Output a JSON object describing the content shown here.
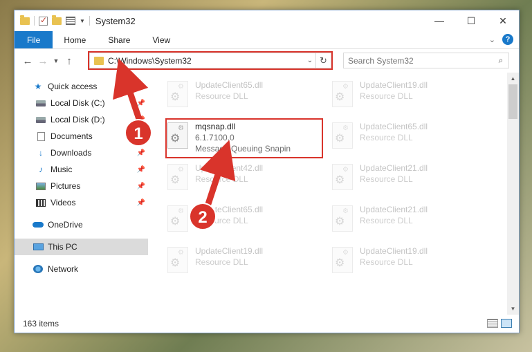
{
  "window": {
    "title": "System32",
    "controls": {
      "minimize": "—",
      "maximize": "☐",
      "close": "✕"
    }
  },
  "ribbon": {
    "tabs": [
      {
        "label": "File"
      },
      {
        "label": "Home"
      },
      {
        "label": "Share"
      },
      {
        "label": "View"
      }
    ]
  },
  "navigation": {
    "address": "C:\\Windows\\System32",
    "search_placeholder": "Search System32"
  },
  "sidebar": {
    "quick_access": "Quick access",
    "items": [
      {
        "label": "Local Disk (C:)"
      },
      {
        "label": "Local Disk (D:)"
      },
      {
        "label": "Documents"
      },
      {
        "label": "Downloads"
      },
      {
        "label": "Music"
      },
      {
        "label": "Pictures"
      },
      {
        "label": "Videos"
      }
    ],
    "onedrive": "OneDrive",
    "this_pc": "This PC",
    "network": "Network"
  },
  "files": [
    {
      "name": "UpdateClient65.dll",
      "type": "Resource DLL"
    },
    {
      "name": "UpdateClient19.dll",
      "type": "Resource DLL"
    },
    {
      "name": "mqsnap.dll",
      "version": "6.1.7100.0",
      "description": "Message Queuing Snapin"
    },
    {
      "name": "UpdateClient65.dll",
      "type": "Resource DLL"
    },
    {
      "name": "UpdateClient42.dll",
      "type": "Resource DLL"
    },
    {
      "name": "UpdateClient21.dll",
      "type": "Resource DLL"
    },
    {
      "name": "UpdateClient65.dll",
      "type": "Resource DLL"
    },
    {
      "name": "UpdateClient21.dll",
      "type": "Resource DLL"
    },
    {
      "name": "UpdateClient19.dll",
      "type": "Resource DLL"
    },
    {
      "name": "UpdateClient19.dll",
      "type": "Resource DLL"
    }
  ],
  "status": {
    "item_count": "163 items"
  },
  "annotations": {
    "step1": "1",
    "step2": "2",
    "color": "#d9342b"
  }
}
